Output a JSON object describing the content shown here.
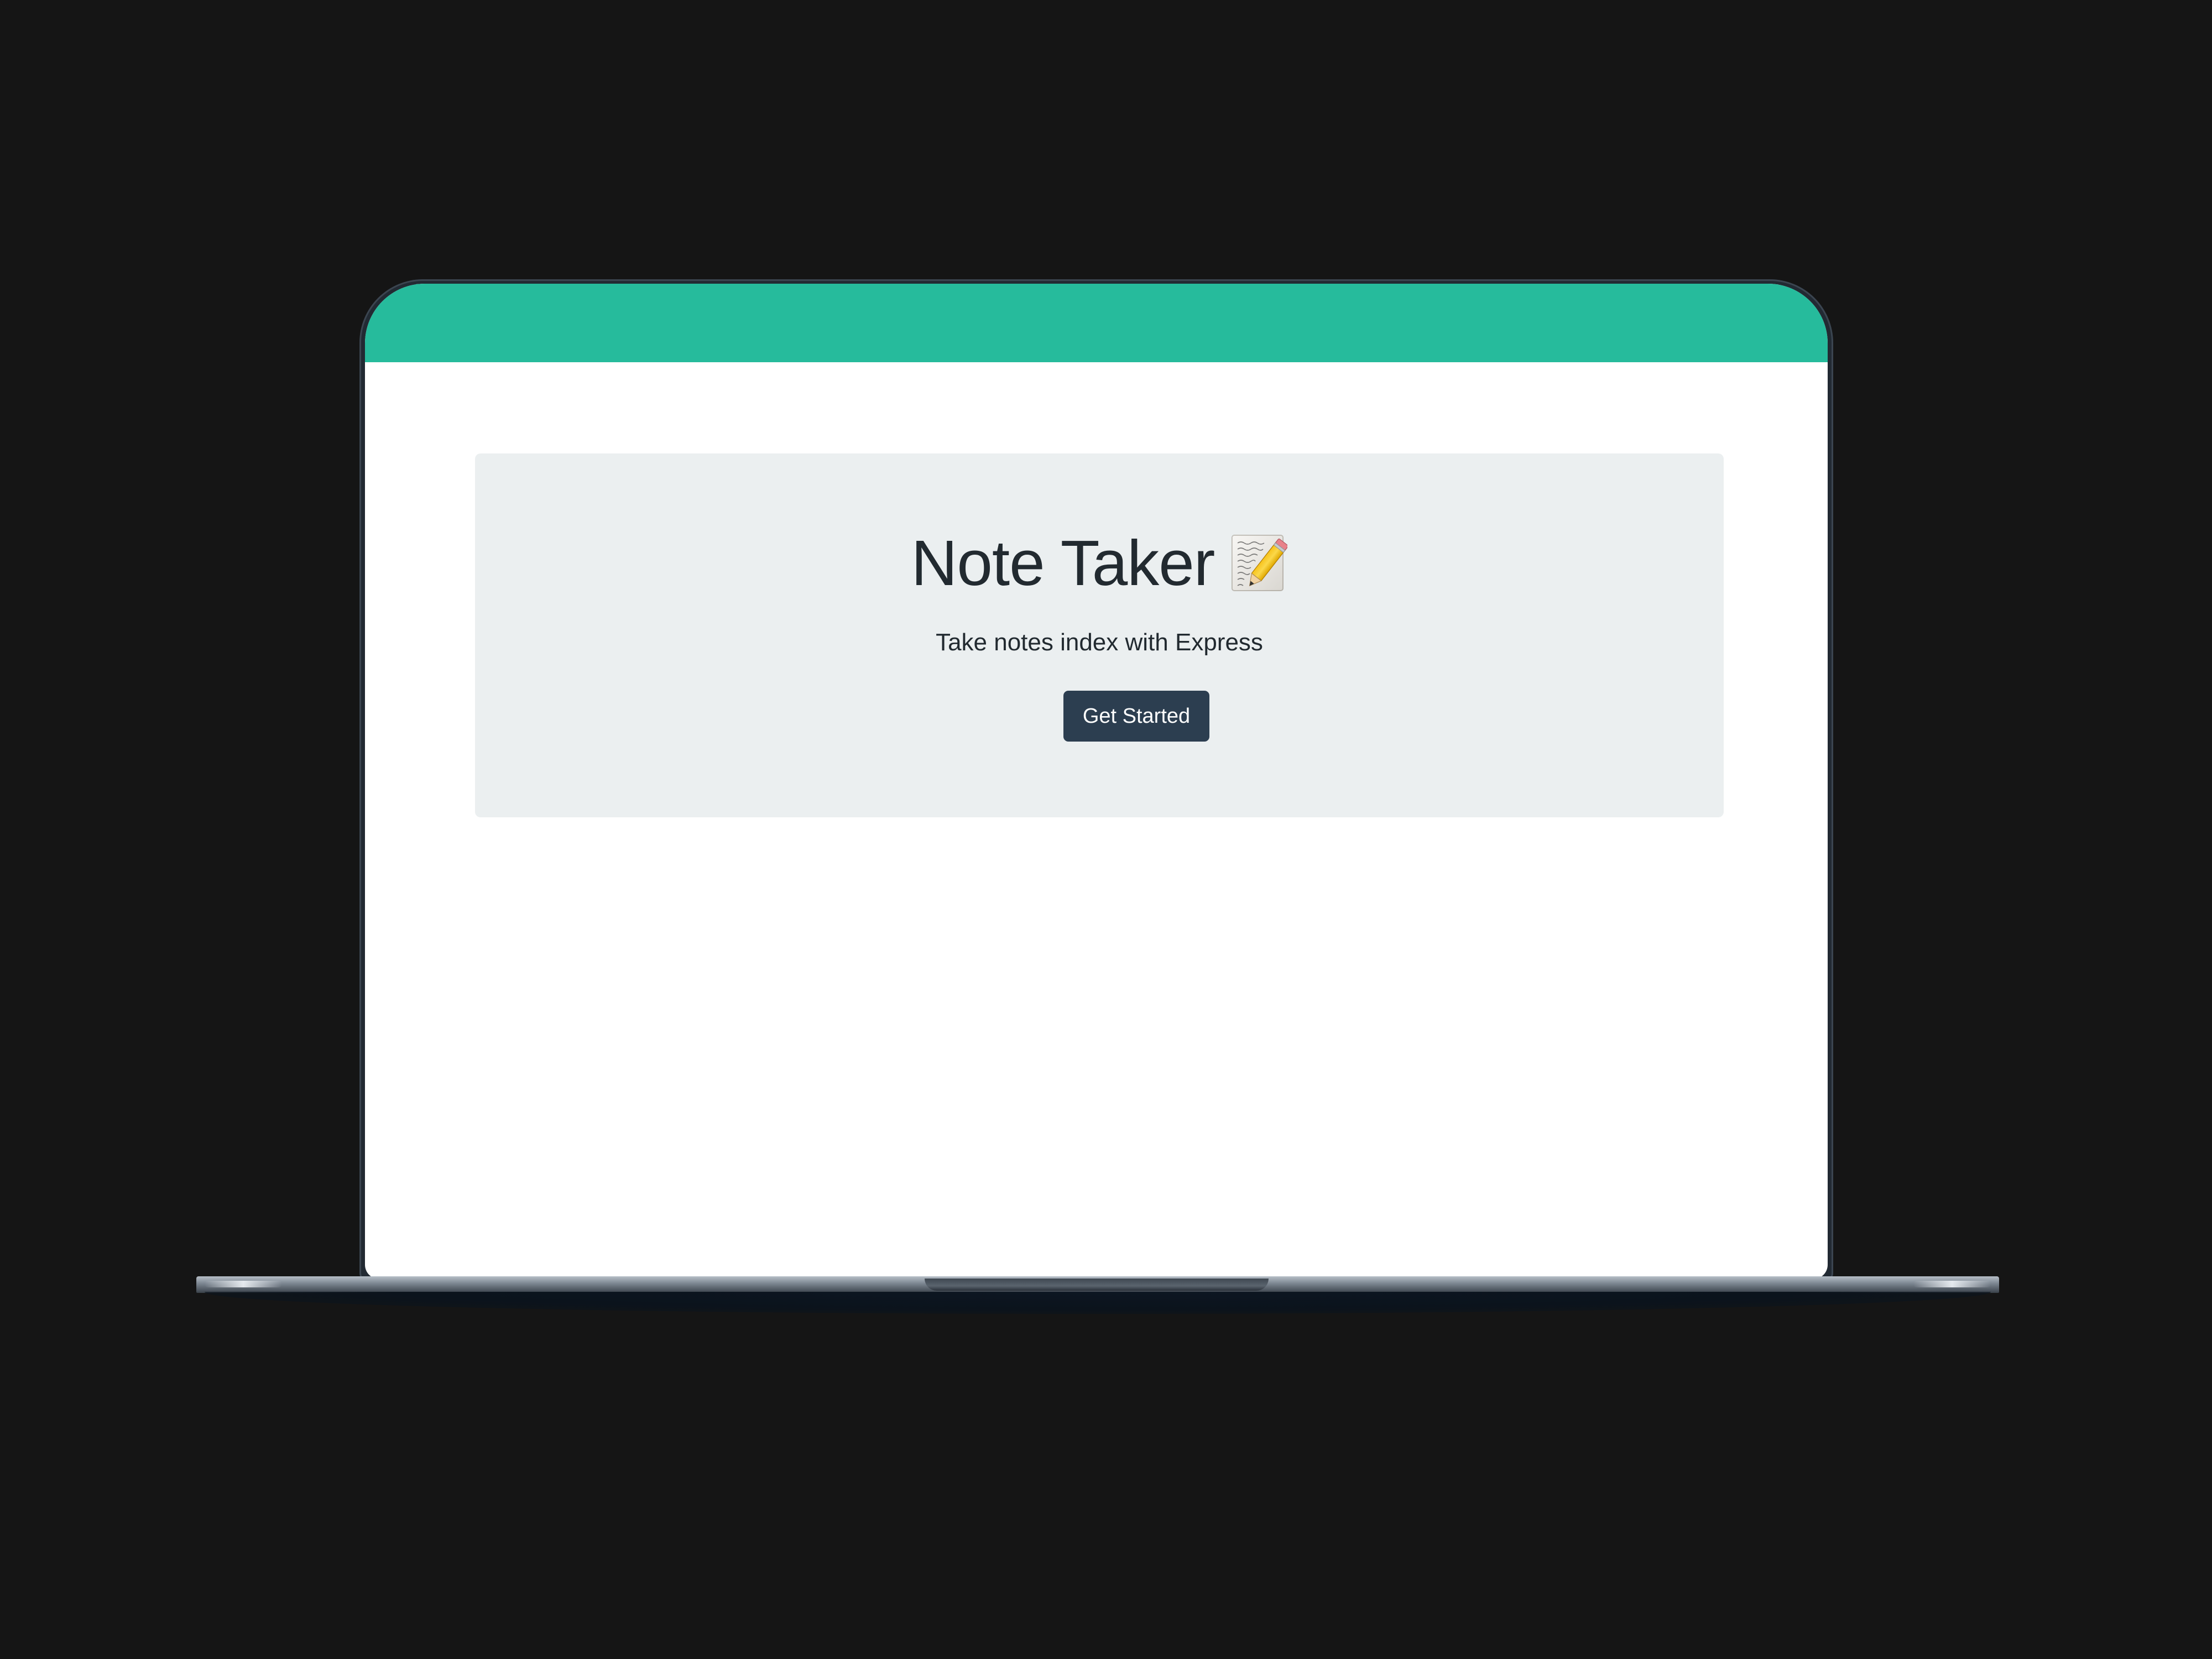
{
  "page": {
    "title": "Note Taker",
    "title_icon": "memo-icon",
    "subtitle": "Take notes index with Express",
    "cta_label": "Get Started"
  },
  "colors": {
    "navbar": "#26bb9c",
    "jumbotron": "#ebeff0",
    "button": "#2c3e50",
    "text": "#222a30",
    "background": "#151515"
  }
}
